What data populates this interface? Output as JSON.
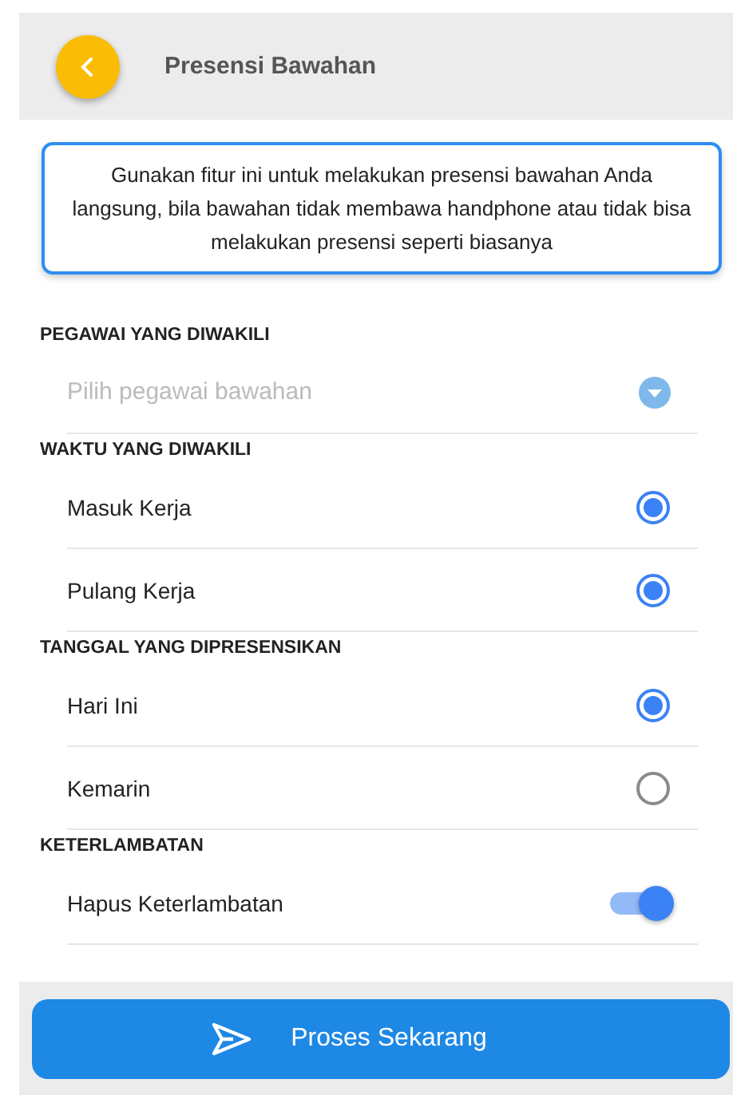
{
  "header": {
    "title": "Presensi Bawahan"
  },
  "info": "Gunakan fitur ini untuk melakukan presensi bawahan Anda langsung, bila bawahan tidak membawa handphone atau tidak bisa melakukan presensi seperti biasanya",
  "sections": [
    {
      "label": "PEGAWAI YANG DIWAKILI",
      "kind": "select",
      "placeholder": "Pilih pegawai bawahan"
    },
    {
      "label": "WAKTU YANG DIWAKILI",
      "kind": "radio",
      "options": [
        {
          "label": "Masuk Kerja",
          "selected": true
        },
        {
          "label": "Pulang Kerja",
          "selected": true
        }
      ]
    },
    {
      "label": "TANGGAL YANG DIPRESENSIKAN",
      "kind": "radio",
      "options": [
        {
          "label": "Hari Ini",
          "selected": true
        },
        {
          "label": "Kemarin",
          "selected": false
        }
      ]
    },
    {
      "label": "KETERLAMBATAN",
      "kind": "toggle",
      "options": [
        {
          "label": "Hapus Keterlambatan",
          "on": true
        }
      ]
    }
  ],
  "button": {
    "label": "Proses Sekarang"
  }
}
